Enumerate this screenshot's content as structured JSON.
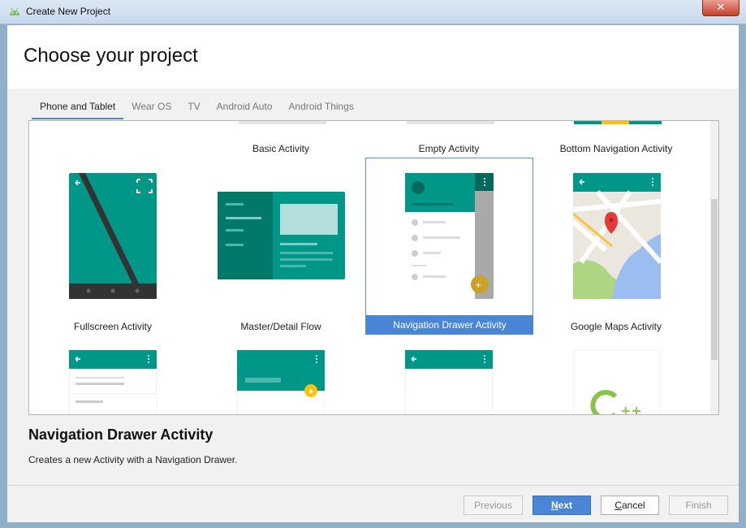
{
  "window": {
    "title": "Create New Project",
    "close_label": "✕"
  },
  "header": {
    "title": "Choose your project"
  },
  "tabs": [
    {
      "label": "Phone and Tablet"
    },
    {
      "label": "Wear OS"
    },
    {
      "label": "TV"
    },
    {
      "label": "Android Auto"
    },
    {
      "label": "Android Things"
    }
  ],
  "templates": {
    "row1": [
      "Basic Activity",
      "Empty Activity",
      "Bottom Navigation Activity"
    ],
    "row2": [
      "Fullscreen Activity",
      "Master/Detail Flow",
      "Navigation Drawer Activity",
      "Google Maps Activity"
    ],
    "selected": "Navigation Drawer Activity"
  },
  "detail": {
    "title": "Navigation Drawer Activity",
    "description": "Creates a new Activity with a Navigation Drawer."
  },
  "buttons": {
    "previous": "Previous",
    "next_n": "N",
    "next_rest": "ext",
    "cancel_c": "C",
    "cancel_rest": "ancel",
    "finish": "Finish"
  },
  "colors": {
    "accent": "#009688",
    "selection": "#4a86d6",
    "fab": "#ffc107"
  }
}
